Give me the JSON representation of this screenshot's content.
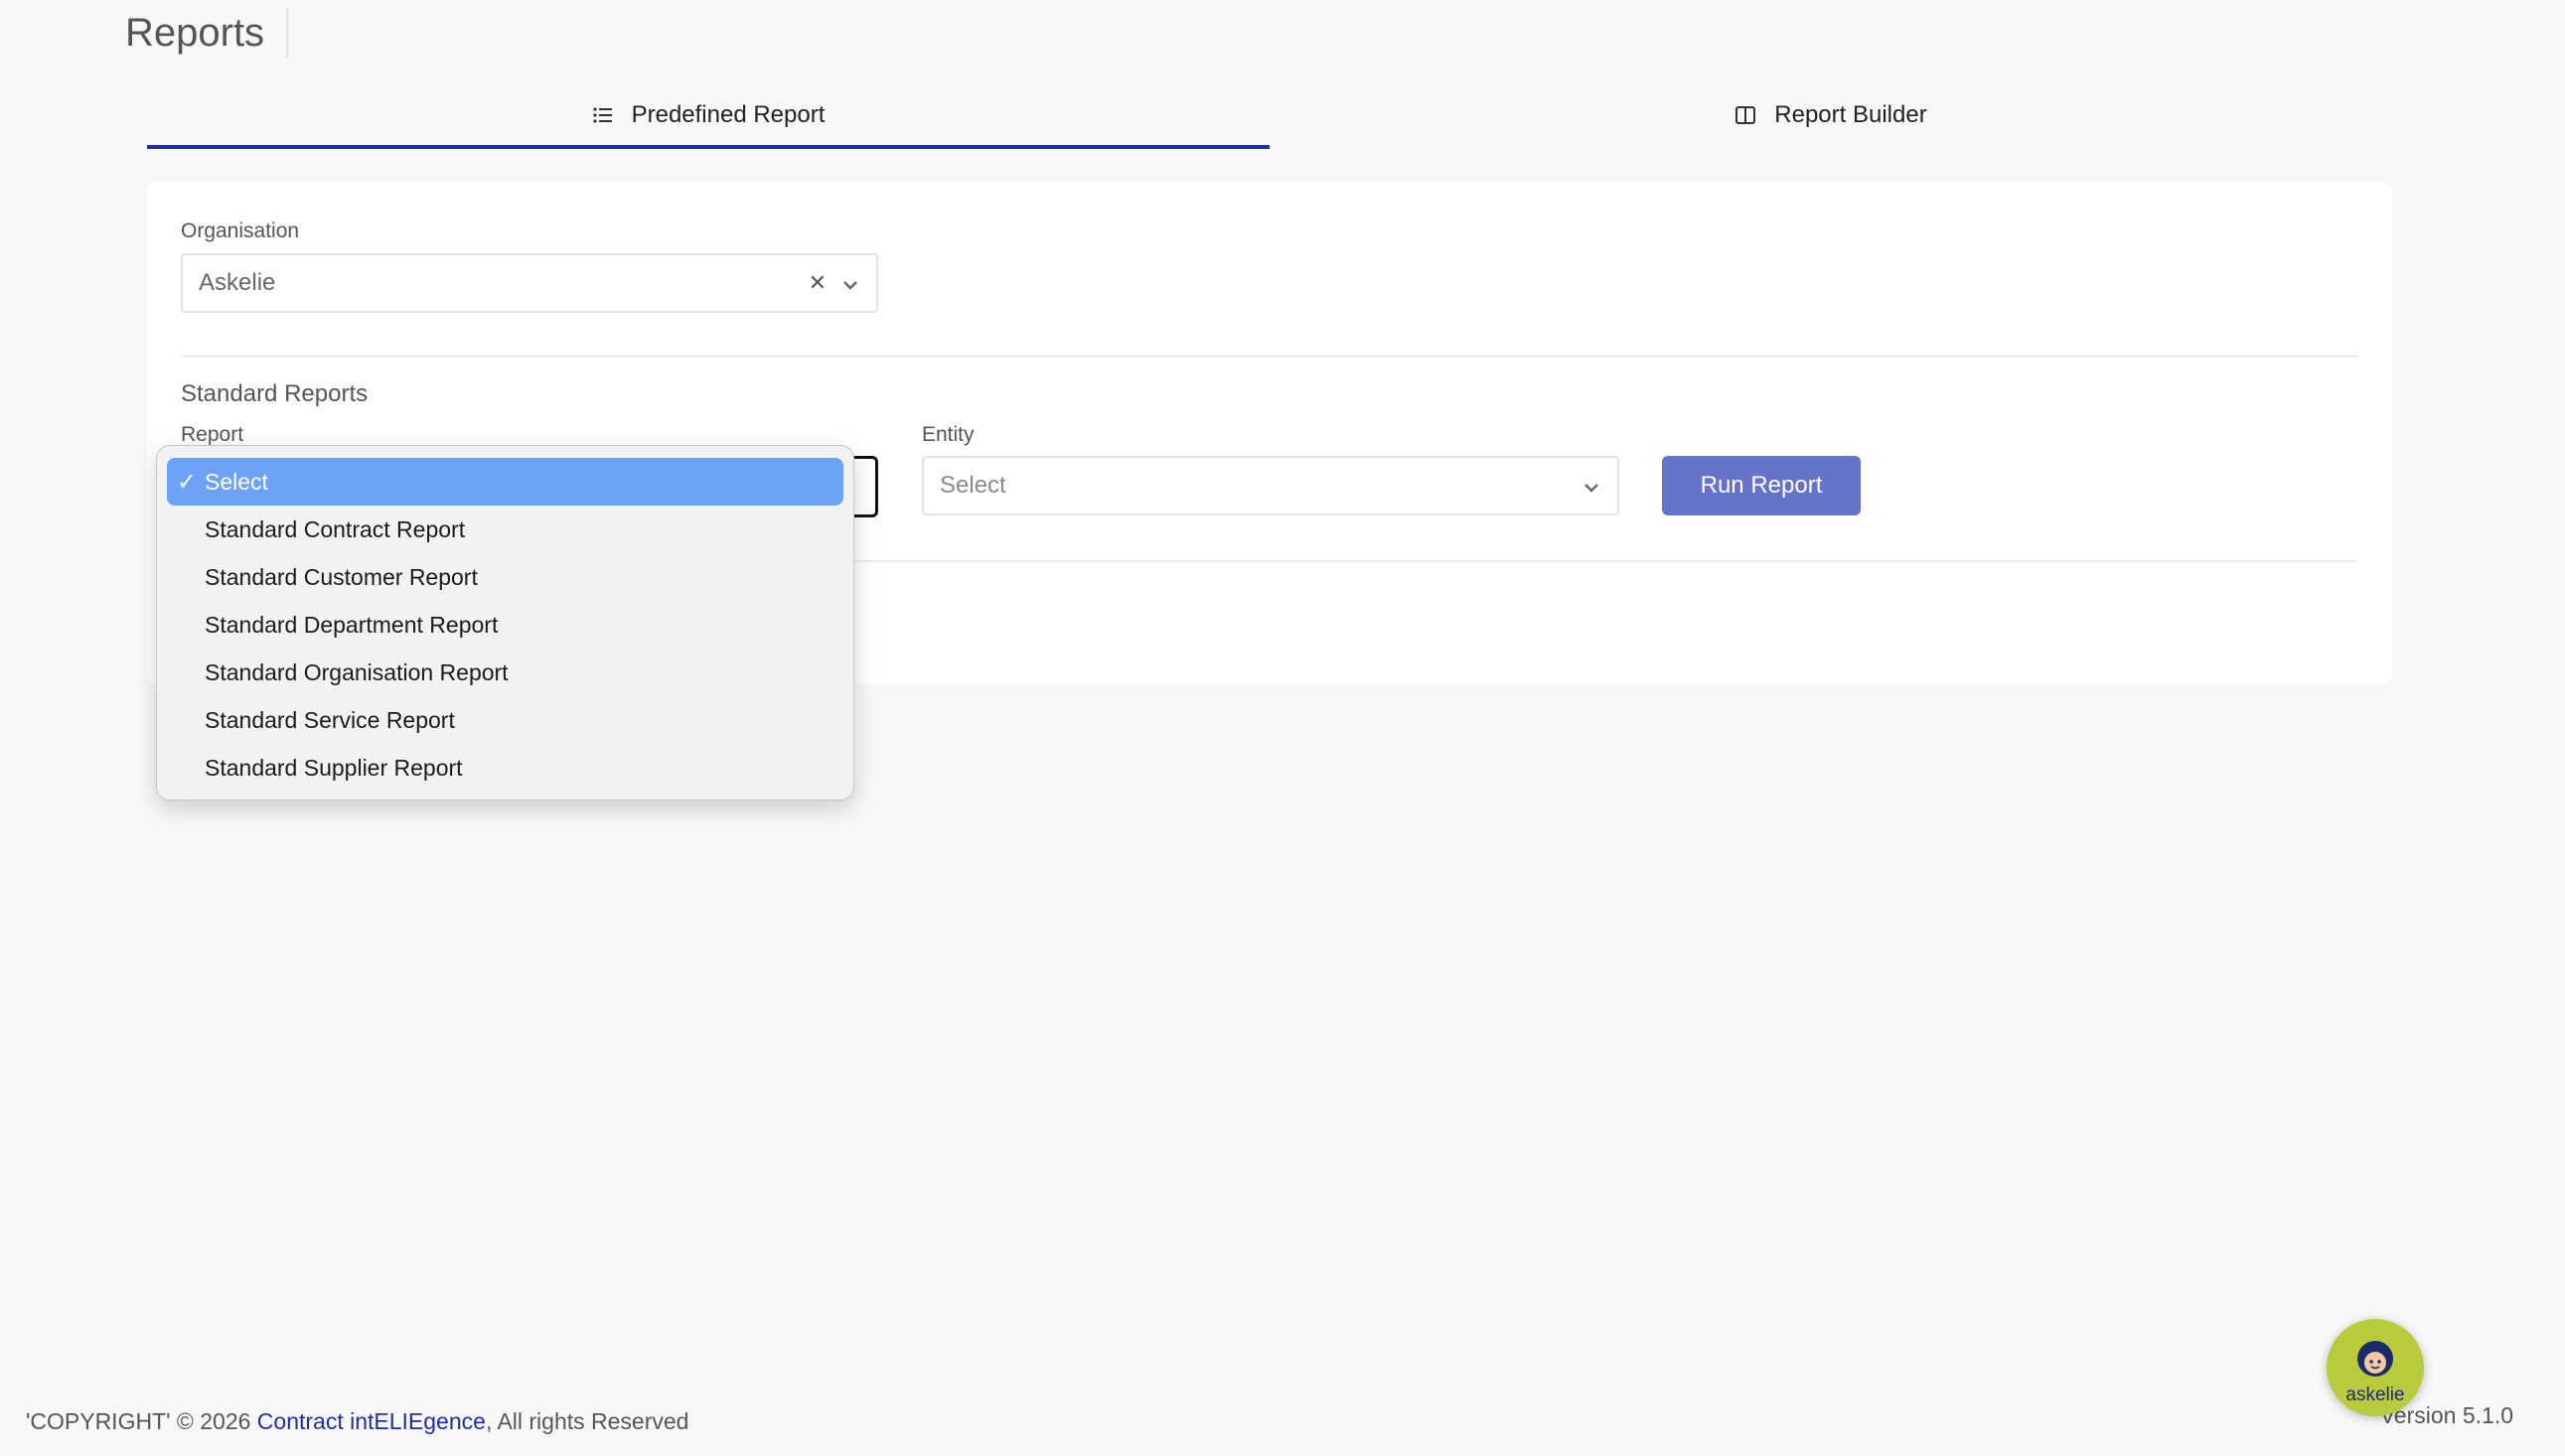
{
  "page": {
    "title": "Reports"
  },
  "tabs": [
    {
      "label": "Predefined Report",
      "icon": "list-icon",
      "active": true
    },
    {
      "label": "Report Builder",
      "icon": "columns-icon",
      "active": false
    }
  ],
  "organisation": {
    "label": "Organisation",
    "value": "Askelie"
  },
  "standard_reports": {
    "title": "Standard Reports",
    "report_label": "Report",
    "entity_label": "Entity",
    "entity_placeholder": "Select",
    "run_button": "Run Report"
  },
  "dropdown": {
    "selected": "Select",
    "options": [
      "Select",
      "Standard Contract Report",
      "Standard Customer Report",
      "Standard Department Report",
      "Standard Organisation Report",
      "Standard Service Report",
      "Standard Supplier Report"
    ]
  },
  "footer": {
    "copyright": "'COPYRIGHT' © 2026",
    "link": "Contract intELIEgence",
    "rights": ", All rights Reserved",
    "version": "Version 5.1.0"
  },
  "assistant": {
    "label": "askelie"
  },
  "colors": {
    "accent": "#1f2fa8",
    "button": "#6573c9",
    "option_selected": "#6ca2f7",
    "assistant_bg": "#b9cb3a"
  }
}
